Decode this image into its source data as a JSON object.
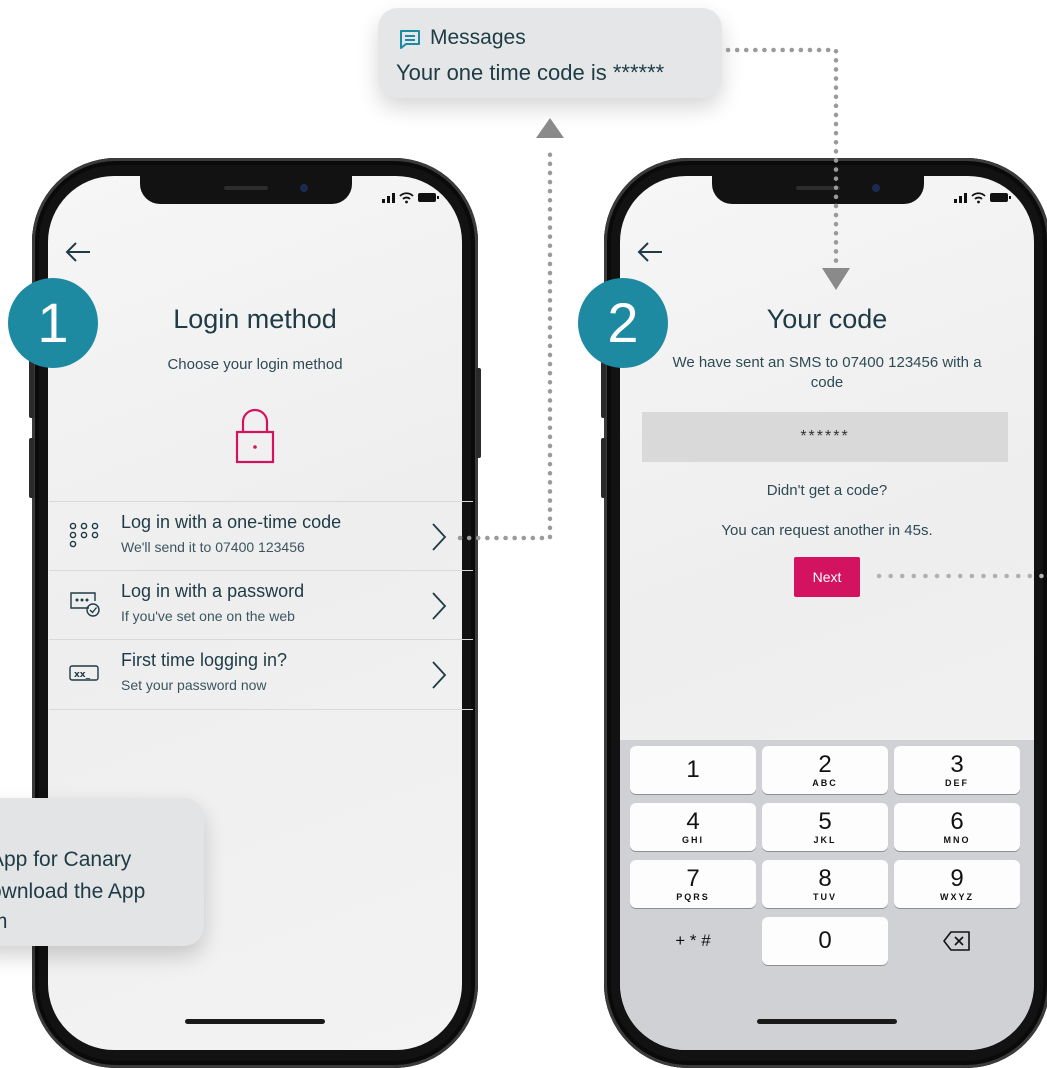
{
  "messages": {
    "app_label": "Messages",
    "body": "Your one time code is ******",
    "icon": "chat-bubble-icon"
  },
  "tooltip": {
    "lines": [
      "App for Canary",
      "ownload the App",
      "m"
    ]
  },
  "phone1": {
    "step": "1",
    "title": "Login method",
    "subtitle": "Choose your login method",
    "options": [
      {
        "title": "Log in with a one-time code",
        "subtitle": "We'll send it to 07400 123456",
        "icon": "keypad-icon"
      },
      {
        "title": "Log in with a password",
        "subtitle": "If you've set one on the web",
        "icon": "password-check-icon"
      },
      {
        "title": "First time logging in?",
        "subtitle": "Set your password now",
        "icon": "password-field-icon"
      }
    ]
  },
  "phone2": {
    "step": "2",
    "title": "Your code",
    "sms_line1": "We have sent an SMS to 07400 123456 with a",
    "sms_line2": "code",
    "code_value": "******",
    "no_code": "Didn't get a code?",
    "resend": "You can request another in 45s.",
    "next_label": "Next",
    "keypad": [
      {
        "digit": "1",
        "letters": ""
      },
      {
        "digit": "2",
        "letters": "ABC"
      },
      {
        "digit": "3",
        "letters": "DEF"
      },
      {
        "digit": "4",
        "letters": "GHI"
      },
      {
        "digit": "5",
        "letters": "JKL"
      },
      {
        "digit": "6",
        "letters": "MNO"
      },
      {
        "digit": "7",
        "letters": "PQRS"
      },
      {
        "digit": "8",
        "letters": "TUV"
      },
      {
        "digit": "9",
        "letters": "WXYZ"
      },
      {
        "digit": "+ * #",
        "letters": ""
      },
      {
        "digit": "0",
        "letters": ""
      }
    ]
  },
  "colors": {
    "teal_badge": "#1d8aa2",
    "brand_pink": "#d3135f",
    "text_dark": "#1e3b46",
    "connector_grey": "#9a9a9a"
  }
}
